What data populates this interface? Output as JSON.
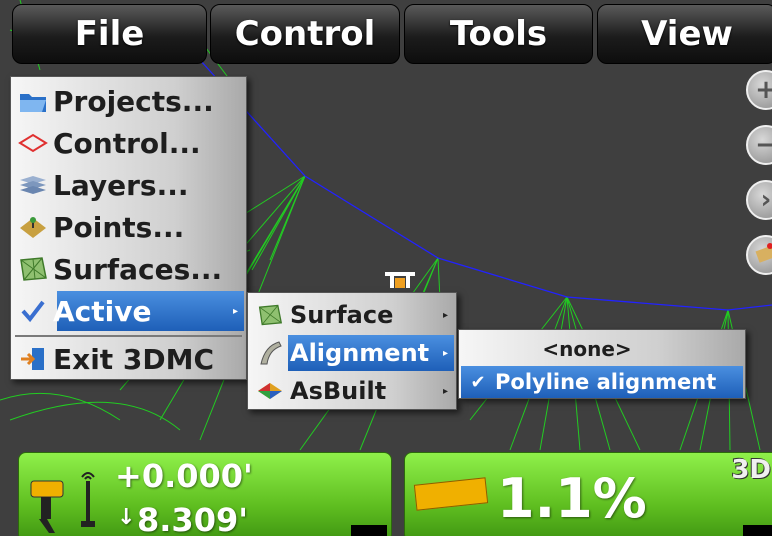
{
  "menubar": {
    "file": "File",
    "control": "Control",
    "tools": "Tools",
    "view": "View"
  },
  "file_menu": {
    "items": [
      {
        "label": "Projects..."
      },
      {
        "label": "Control..."
      },
      {
        "label": "Layers..."
      },
      {
        "label": "Points..."
      },
      {
        "label": "Surfaces..."
      },
      {
        "label": "Active"
      },
      {
        "label": "Exit 3DMC"
      }
    ]
  },
  "active_menu": {
    "items": [
      {
        "label": "Surface"
      },
      {
        "label": "Alignment"
      },
      {
        "label": "AsBuilt"
      }
    ]
  },
  "alignment_menu": {
    "items": [
      {
        "label": "<none>"
      },
      {
        "label": "Polyline alignment"
      }
    ]
  },
  "status": {
    "elevation_offset": "+0.000'",
    "cut_fill": "8.309'",
    "slope": "1.1%",
    "view_mode": "3D"
  },
  "colors": {
    "panel_green": "#5fbe20",
    "menu_highlight": "#1e5fb8",
    "alignment_line": "#2222ff",
    "surface_lines": "#22cc22",
    "slope_indicator": "#f0b000"
  }
}
